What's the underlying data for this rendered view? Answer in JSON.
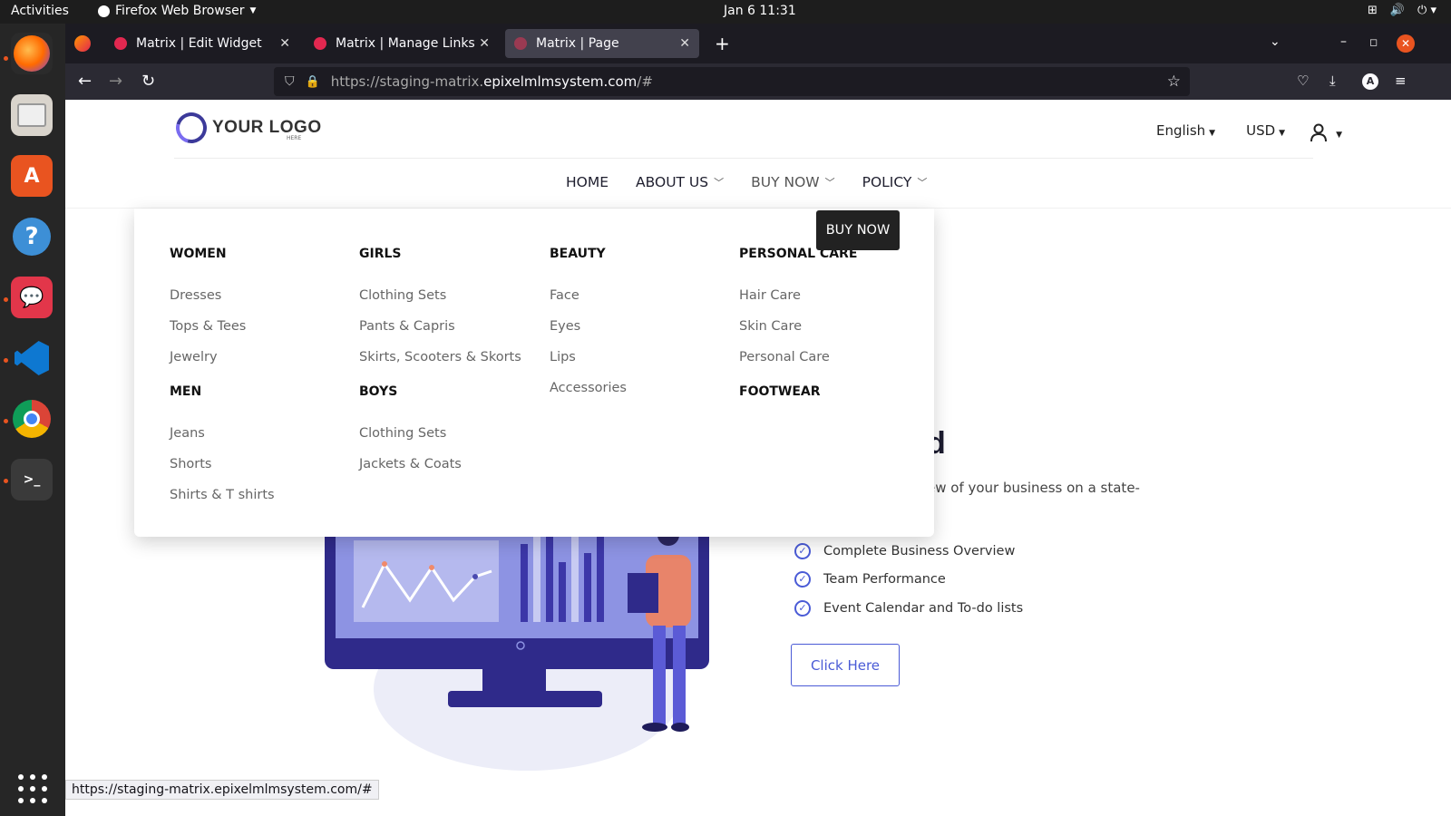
{
  "system": {
    "activities": "Activities",
    "app_name": "Firefox Web Browser",
    "clock": "Jan 6  11:31"
  },
  "browser": {
    "tabs": [
      {
        "label": "Matrix | Edit Widget"
      },
      {
        "label": "Matrix | Manage Links"
      },
      {
        "label": "Matrix | Page"
      }
    ],
    "url_dim": "https://staging-matrix.",
    "url_domain": "epixelmlmsystem.com",
    "url_rest": "/#",
    "account_initial": "A",
    "status_url": "https://staging-matrix.epixelmlmsystem.com/#"
  },
  "site": {
    "logo_text": "YOUR LOGO",
    "logo_sub": "HERE",
    "language": "English",
    "currency": "USD",
    "nav": {
      "home": "HOME",
      "about": "ABOUT US",
      "buy_now": "BUY NOW",
      "policy": "POLICY"
    },
    "buy_now_tooltip": "BUY NOW"
  },
  "megamenu": {
    "col1": {
      "cat1": "WOMEN",
      "cat1_items": [
        "Dresses",
        "Tops & Tees",
        "Jewelry"
      ],
      "cat2": "MEN",
      "cat2_items": [
        "Jeans",
        "Shorts",
        "Shirts & T shirts"
      ]
    },
    "col2": {
      "cat1": "GIRLS",
      "cat1_items": [
        "Clothing Sets",
        "Pants & Capris",
        "Skirts, Scooters & Skorts"
      ],
      "cat2": "BOYS",
      "cat2_items": [
        "Clothing Sets",
        "Jackets & Coats"
      ]
    },
    "col3": {
      "cat1": "BEAUTY",
      "cat1_items": [
        "Face",
        "Eyes",
        "Lips",
        "Accessories"
      ]
    },
    "col4": {
      "cat1": "PERSONAL CARE",
      "cat1_items": [
        "Hair Care",
        "Skin Care",
        "Personal Care"
      ],
      "cat2": "FOOTWEAR"
    }
  },
  "hero": {
    "title_visible": "d",
    "desc_visible": "ew of your business on a state-",
    "features": [
      "Complete Business Overview",
      "Team Performance",
      "Event Calendar and To-do lists"
    ],
    "cta": "Click Here"
  }
}
